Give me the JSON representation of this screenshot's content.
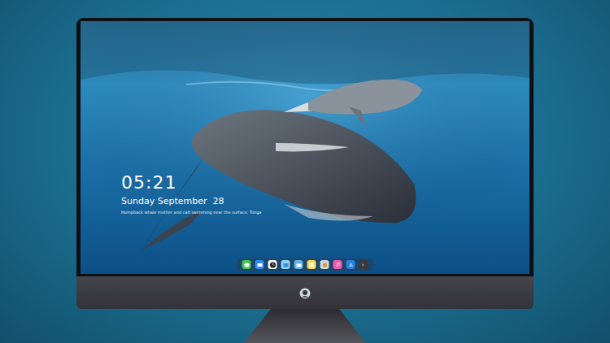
{
  "screen": {
    "clock": {
      "time": "05:21",
      "date": "Sunday September  28",
      "caption": "Humpback whale mother and calf swimming near the surface, Tonga"
    }
  }
}
